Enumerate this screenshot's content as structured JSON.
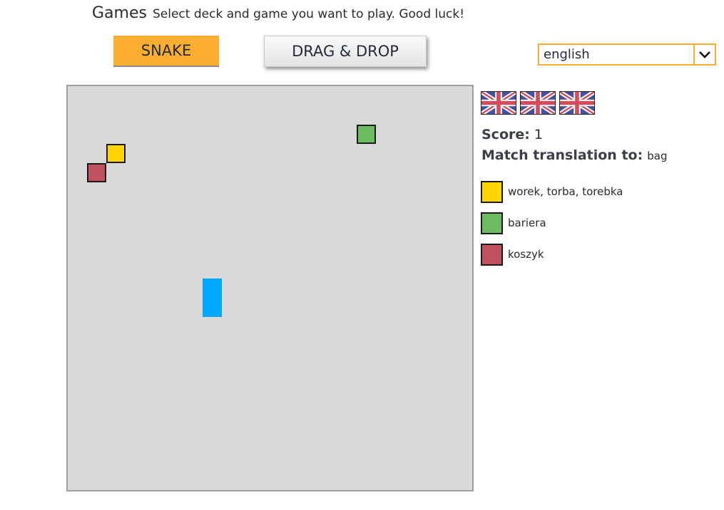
{
  "header": {
    "title": "Games",
    "subtitle": "Select deck and game you want to play. Good luck!"
  },
  "buttons": {
    "snake_label": "SNAKE",
    "dragdrop_label": "DRAG & DROP"
  },
  "language_select": {
    "value": "english",
    "icon": "chevron-down-icon",
    "accent_color": "#fbae2f"
  },
  "lives": {
    "count": 3,
    "icon": "uk-flag-icon"
  },
  "score": {
    "label": "Score:",
    "value": "1"
  },
  "match": {
    "label": "Match translation to:",
    "word": "bag"
  },
  "options": [
    {
      "label": "worek, torba, torebka",
      "color": "#ffd500"
    },
    {
      "label": "bariera",
      "color": "#6dbb60"
    },
    {
      "label": "koszyk",
      "color": "#c0505e"
    }
  ],
  "colors": {
    "accent": "#fbae2f",
    "board": "#d9d9d9",
    "snake": "#00a8ff"
  }
}
